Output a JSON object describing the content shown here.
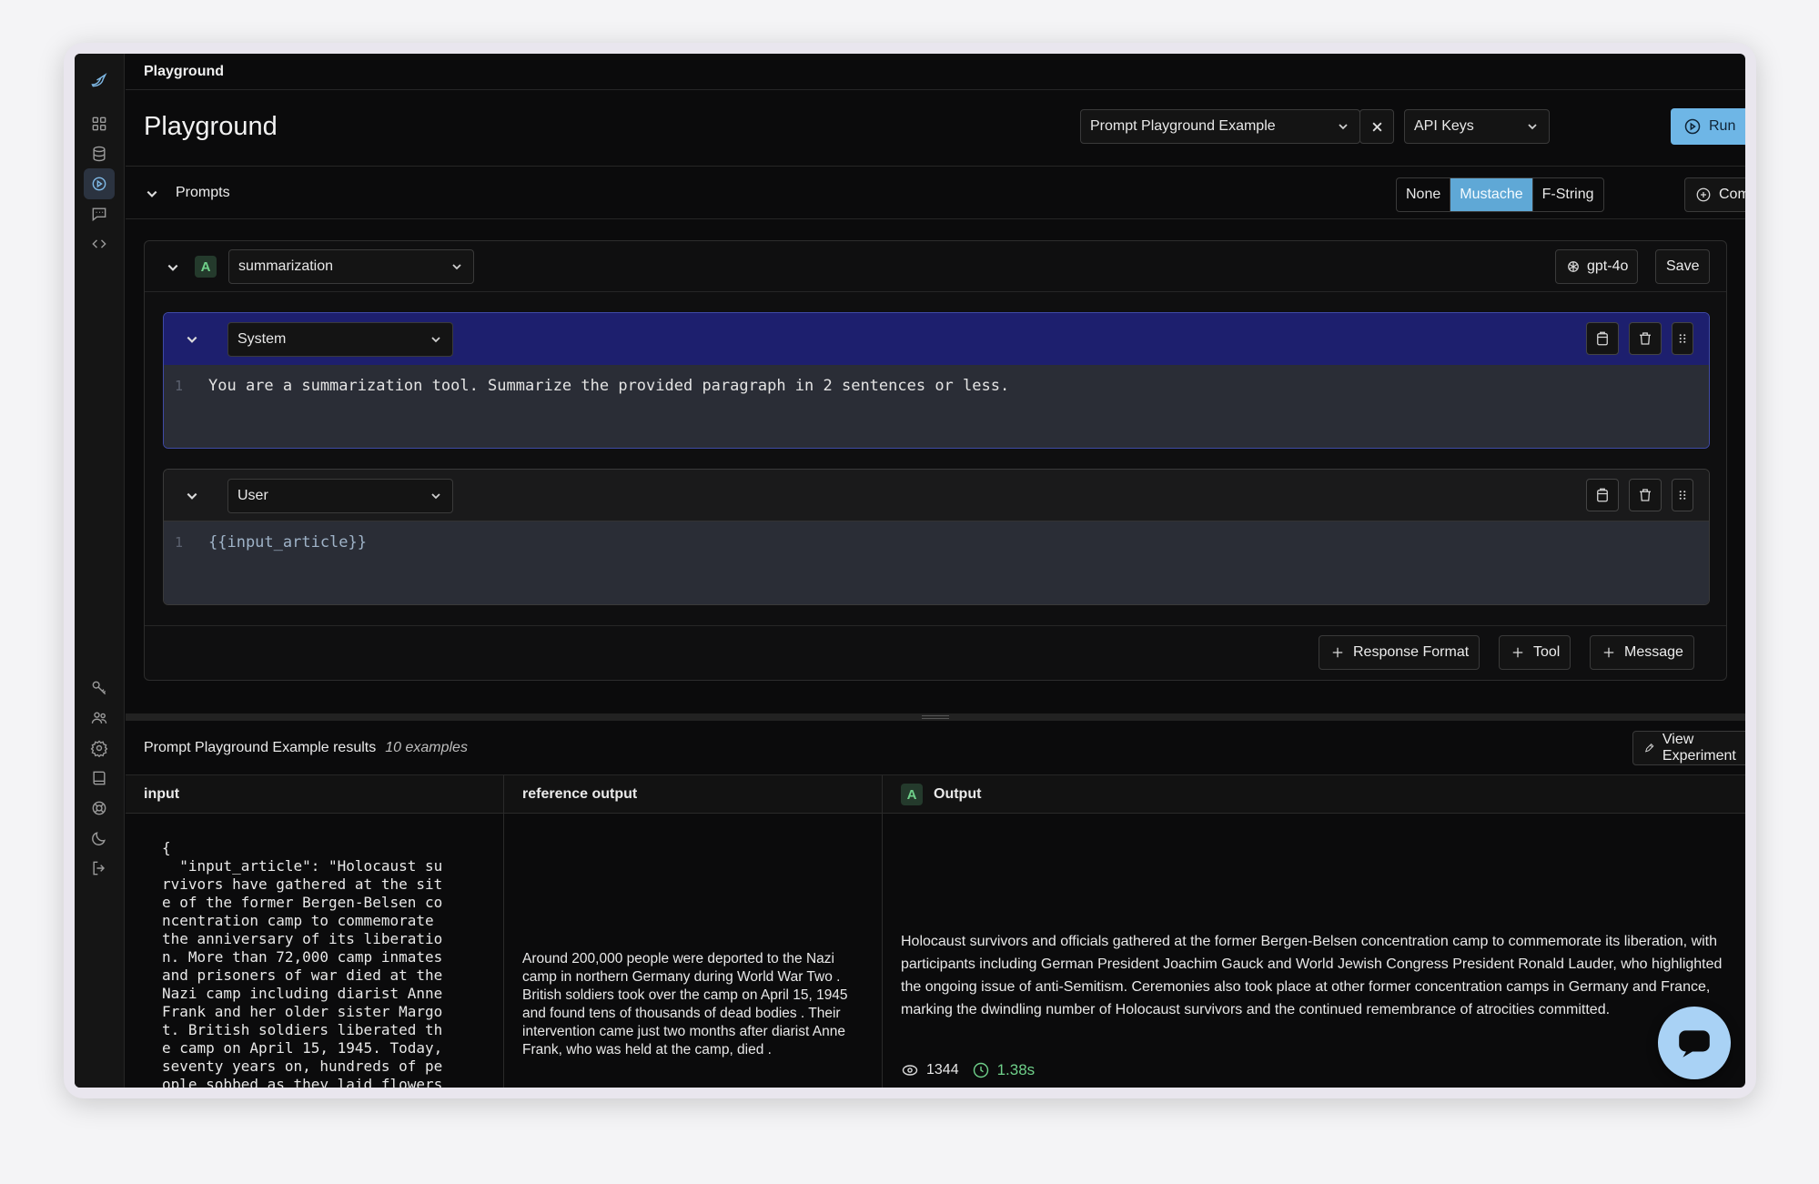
{
  "breadcrumb": "Playground",
  "header": {
    "title": "Playground",
    "dataset_select": "Prompt Playground Example",
    "api_keys_select": "API Keys",
    "run_label": "Run",
    "run_shortcut": "⌘⏎"
  },
  "prompts": {
    "label": "Prompts",
    "template_modes": [
      "None",
      "Mustache",
      "F-String"
    ],
    "active_mode": "Mustache",
    "compare_label": "Compare"
  },
  "prompt_card": {
    "badge": "A",
    "prompt_name": "summarization",
    "model": "gpt-4o",
    "save_label": "Save",
    "messages": [
      {
        "role": "System",
        "line": "1",
        "content": "You are a summarization tool. Summarize the provided paragraph in 2 sentences or less."
      },
      {
        "role": "User",
        "line": "1",
        "content": "{{input_article}}"
      }
    ],
    "footer_buttons": [
      "Response Format",
      "Tool",
      "Message"
    ]
  },
  "results": {
    "title": "Prompt Playground Example results",
    "count": "10 examples",
    "view_experiment_label": "View Experiment",
    "columns": [
      "input",
      "reference output",
      "Output"
    ],
    "output_badge": "A",
    "input_json": "{\n  \"input_article\": \"Holocaust su\nrvivors have gathered at the sit\ne of the former Bergen-Belsen co\nncentration camp to commemorate\nthe anniversary of its liberatio\nn. More than 72,000 camp inmates\nand prisoners of war died at the\nNazi camp including diarist Anne\nFrank and her older sister Margo\nt. British soldiers liberated th\ne camp on April 15, 1945. Today,\nseventy years on, hundreds of pe\nople sobbed as they laid flowers",
    "reference_output": "Around 200,000 people were deported to the Nazi camp in northern Germany during World War Two . British soldiers took over the camp on April 15, 1945 and found tens of thousands of dead bodies . Their intervention came just two months after diarist Anne Frank, who was held at the camp, died .",
    "output": "Holocaust survivors and officials gathered at the former Bergen-Belsen concentration camp to commemorate its liberation, with participants including German President Joachim Gauck and World Jewish Congress President Ronald Lauder, who highlighted the ongoing issue of anti-Semitism. Ceremonies also took place at other former concentration camps in Germany and France, marking the dwindling number of Holocaust survivors and the continued remembrance of atrocities committed.",
    "tokens": "1344",
    "latency": "1.38s"
  },
  "colors": {
    "accent": "#6eb6e6",
    "system_header": "#1d1f6e",
    "badge_green": "#6fd08a"
  }
}
